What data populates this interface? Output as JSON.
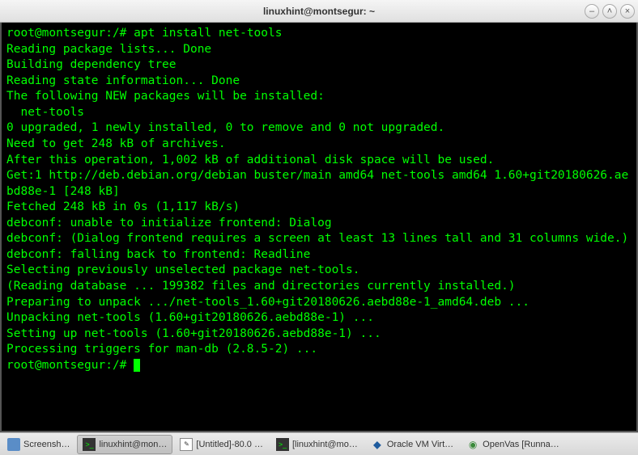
{
  "window": {
    "title": "linuxhint@montsegur: ~"
  },
  "terminal": {
    "prompt1": "root@montsegur:/# ",
    "command1": "apt install net-tools",
    "lines": [
      "Reading package lists... Done",
      "Building dependency tree",
      "Reading state information... Done",
      "The following NEW packages will be installed:",
      "  net-tools",
      "0 upgraded, 1 newly installed, 0 to remove and 0 not upgraded.",
      "Need to get 248 kB of archives.",
      "After this operation, 1,002 kB of additional disk space will be used.",
      "Get:1 http://deb.debian.org/debian buster/main amd64 net-tools amd64 1.60+git20180626.aebd88e-1 [248 kB]",
      "Fetched 248 kB in 0s (1,117 kB/s)",
      "debconf: unable to initialize frontend: Dialog",
      "debconf: (Dialog frontend requires a screen at least 13 lines tall and 31 columns wide.)",
      "debconf: falling back to frontend: Readline",
      "Selecting previously unselected package net-tools.",
      "(Reading database ... 199382 files and directories currently installed.)",
      "Preparing to unpack .../net-tools_1.60+git20180626.aebd88e-1_amd64.deb ...",
      "Unpacking net-tools (1.60+git20180626.aebd88e-1) ...",
      "Setting up net-tools (1.60+git20180626.aebd88e-1) ...",
      "Processing triggers for man-db (2.8.5-2) ..."
    ],
    "prompt2": "root@montsegur:/#"
  },
  "taskbar": {
    "items": [
      {
        "label": "Screensh…"
      },
      {
        "label": "linuxhint@mon…"
      },
      {
        "label": "[Untitled]-80.0 …"
      },
      {
        "label": "[linuxhint@mo…"
      },
      {
        "label": "Oracle VM Virt…"
      },
      {
        "label": "OpenVas [Runna…"
      }
    ]
  }
}
